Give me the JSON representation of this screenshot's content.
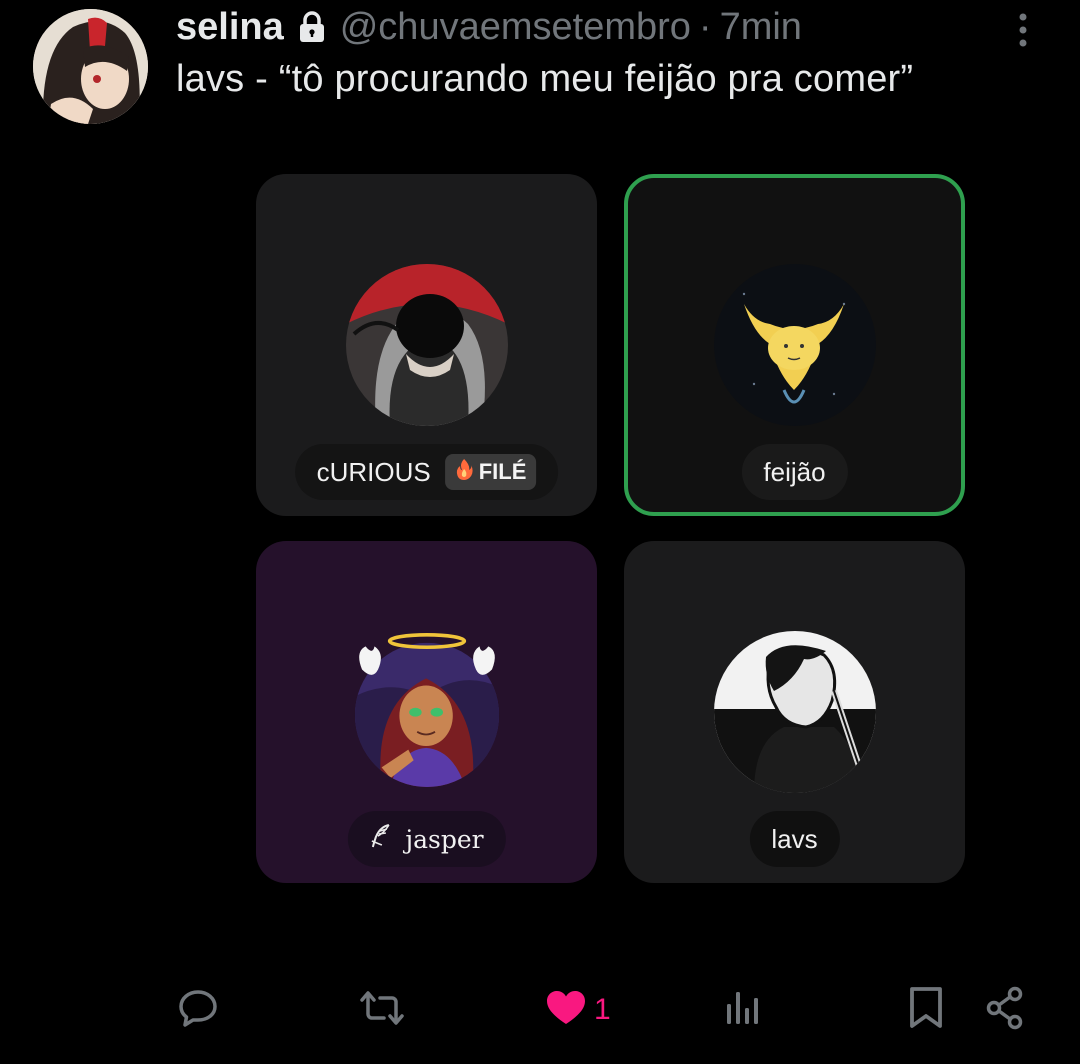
{
  "post": {
    "author_name": "selina",
    "handle": "@chuvaemsetembro",
    "separator": "·",
    "time": "7min",
    "text": "lavs - “tô procurando meu feijão pra comer”"
  },
  "cards": [
    {
      "name": "cURIOUS",
      "badge": "FILÉ",
      "selected": false
    },
    {
      "name": "feijão",
      "selected": true
    },
    {
      "name": "jasper",
      "selected": false
    },
    {
      "name": "lavs",
      "selected": false
    }
  ],
  "actions": {
    "reply_count": "",
    "repost_count": "",
    "like_count": "1",
    "liked": true,
    "views_count": ""
  },
  "colors": {
    "background": "#000000",
    "text_primary": "#e7e9ea",
    "text_secondary": "#71767b",
    "like": "#f91880",
    "selected_border": "#2fa04f"
  },
  "icons": [
    "lock-icon",
    "more-icon",
    "reply-icon",
    "repost-icon",
    "heart-icon",
    "views-icon",
    "bookmark-icon",
    "share-icon",
    "fire-icon"
  ]
}
